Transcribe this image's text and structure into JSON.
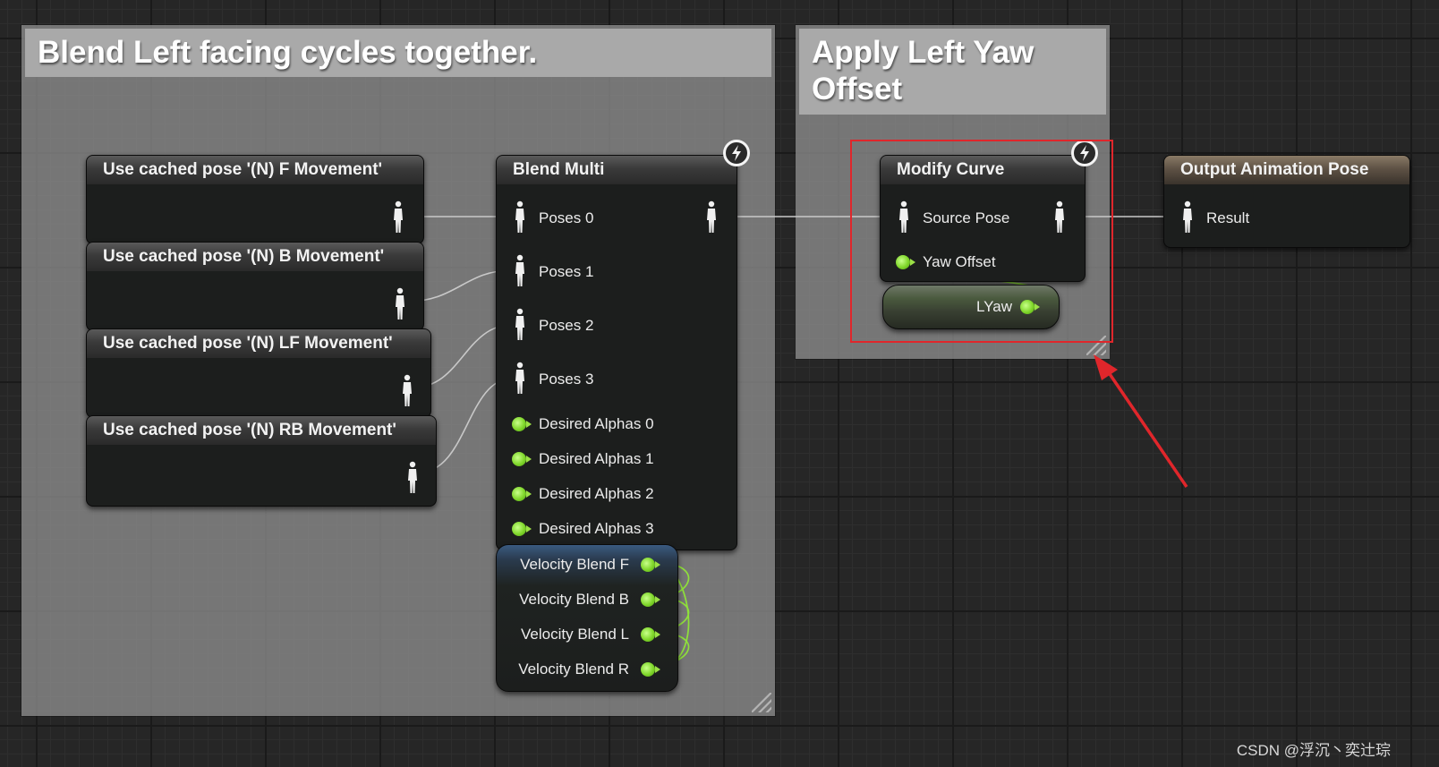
{
  "comments": {
    "blend": {
      "title": "Blend Left facing cycles together."
    },
    "yaw": {
      "title": "Apply Left Yaw Offset"
    }
  },
  "cached_nodes": [
    {
      "label": "Use cached pose '(N) F Movement'"
    },
    {
      "label": "Use cached pose '(N) B Movement'"
    },
    {
      "label": "Use cached pose '(N) LF Movement'"
    },
    {
      "label": "Use cached pose '(N) RB Movement'"
    }
  ],
  "blend_multi": {
    "title": "Blend Multi",
    "pose_pins": [
      "Poses 0",
      "Poses 1",
      "Poses 2",
      "Poses 3"
    ],
    "alpha_pins": [
      "Desired Alphas 0",
      "Desired Alphas 1",
      "Desired Alphas 2",
      "Desired Alphas 3"
    ]
  },
  "velocity_node": {
    "pins": [
      "Velocity Blend F",
      "Velocity Blend B",
      "Velocity Blend L",
      "Velocity Blend R"
    ]
  },
  "modify_curve": {
    "title": "Modify Curve",
    "source_pose": "Source Pose",
    "yaw_offset": "Yaw Offset"
  },
  "lyaw": {
    "label": "LYaw"
  },
  "output_pose": {
    "title": "Output Animation Pose",
    "result": "Result"
  },
  "watermark": "CSDN @浮沉丶奕辻琮",
  "colors": {
    "float_pin": "#7fd62a",
    "highlight_box": "#e0262b",
    "arrow": "#e0262b",
    "output_header": "#8a7a66"
  }
}
